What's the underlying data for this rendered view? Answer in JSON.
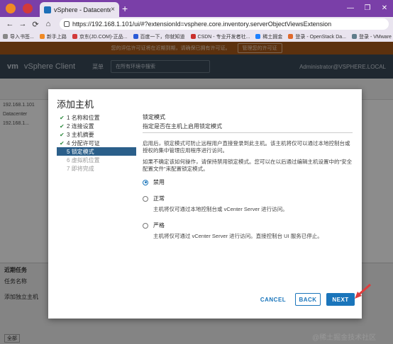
{
  "browser": {
    "tab_label": "vSphere - Datacenter - 摘要",
    "tab_close": "×",
    "new_tab": "+",
    "window_controls": [
      "—",
      "❐",
      "✕"
    ],
    "url": "https://192.168.1.101/ui/#?extensionId=vsphere.core.inventory.serverObjectViewsExtension",
    "nav": {
      "back": "←",
      "forward": "→",
      "reload": "⟳",
      "home": "⌂"
    },
    "bookmarks": [
      "导入书签...",
      "新手上路",
      "京东(JD.COM)-正品...",
      "百度一下，你就知道",
      "CSDN - 专业开发者社...",
      "稀土掘金",
      "登录 - OpenStack Da...",
      "登录 - VMware ESXi"
    ]
  },
  "vsphere": {
    "notice": "您的评估许可证将在近期到期，请确保已拥有许可证。",
    "notice_button": "管理您的许可证",
    "logo": "vm",
    "app_title": "vSphere Client",
    "menu_label": "菜单",
    "search_placeholder": "在所有环境中搜索",
    "user": "Administrator@VSPHERE.LOCAL",
    "tree": [
      "192.168.1.101",
      "Datacenter",
      "192.168.1..."
    ],
    "recent_tasks": "近期任务",
    "task_column": "任务名称",
    "task_row": "添加独立主机",
    "footer_select": "全部"
  },
  "dialog": {
    "title": "添加主机",
    "steps": [
      {
        "num": "1",
        "label": "名称和位置",
        "done": true
      },
      {
        "num": "2",
        "label": "连接设置",
        "done": true
      },
      {
        "num": "3",
        "label": "主机摘要",
        "done": true
      },
      {
        "num": "4",
        "label": "分配许可证",
        "done": true
      },
      {
        "num": "5",
        "label": "锁定模式",
        "done": false,
        "active": true
      },
      {
        "num": "6",
        "label": "虚拟机位置",
        "done": false
      },
      {
        "num": "7",
        "label": "即将完成",
        "done": false
      }
    ],
    "check_glyph": "✔",
    "section_title": "锁定模式",
    "section_subtitle": "指定是否在主机上启用锁定模式",
    "para1": "启用后，锁定模式可防止远程用户直接登录到此主机。该主机将仅可以通过本地控制台或授权的集中管理应用程序进行访问。",
    "para2": "如果不确定该如何操作，请保持禁用锁定模式。您可以在以后通过编辑主机设置中的\"安全配置文件\"来配置锁定模式。",
    "options": [
      {
        "label": "禁用",
        "desc": "",
        "selected": true
      },
      {
        "label": "正常",
        "desc": "主机将仅可通过本地控制台或 vCenter Server 进行访问。",
        "selected": false
      },
      {
        "label": "严格",
        "desc": "主机将仅可通过 vCenter Server 进行访问。直接控制台 UI 服务已停止。",
        "selected": false
      }
    ],
    "cancel_label": "CANCEL",
    "back_label": "BACK",
    "next_label": "NEXT"
  },
  "watermark": "@稀土掘金技术社区",
  "colors": {
    "accent": "#1a75bb",
    "tabbar": "#7a3fa8",
    "notice": "#a85a1a",
    "header": "#3a4a58",
    "active_step": "#2b5f8a",
    "check": "#2e8b3e",
    "arrow": "#e03c3c"
  }
}
